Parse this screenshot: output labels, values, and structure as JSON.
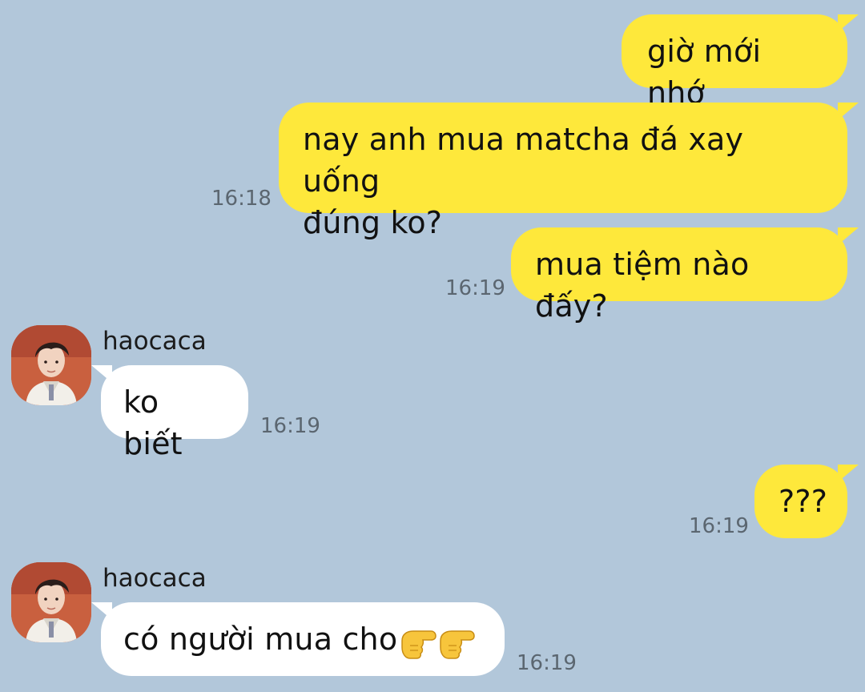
{
  "theme": {
    "background": "#b2c7da",
    "outgoing_bubble": "#fee83b",
    "incoming_bubble": "#ffffff",
    "timestamp_color": "#5b6670"
  },
  "messages": [
    {
      "direction": "outgoing",
      "text": "giờ mới nhớ",
      "time": ""
    },
    {
      "direction": "outgoing",
      "text": "nay anh mua matcha đá xay uống\nđúng ko?",
      "time": "16:18"
    },
    {
      "direction": "outgoing",
      "text": "mua tiệm nào đấy?",
      "time": "16:19"
    },
    {
      "direction": "incoming",
      "sender": "haocaca",
      "text": "ko biết",
      "time": "16:19"
    },
    {
      "direction": "outgoing",
      "text": "???",
      "time": "16:19"
    },
    {
      "direction": "incoming",
      "sender": "haocaca",
      "text": "có người mua cho",
      "emoji": "👉👉",
      "time": "16:19"
    }
  ]
}
